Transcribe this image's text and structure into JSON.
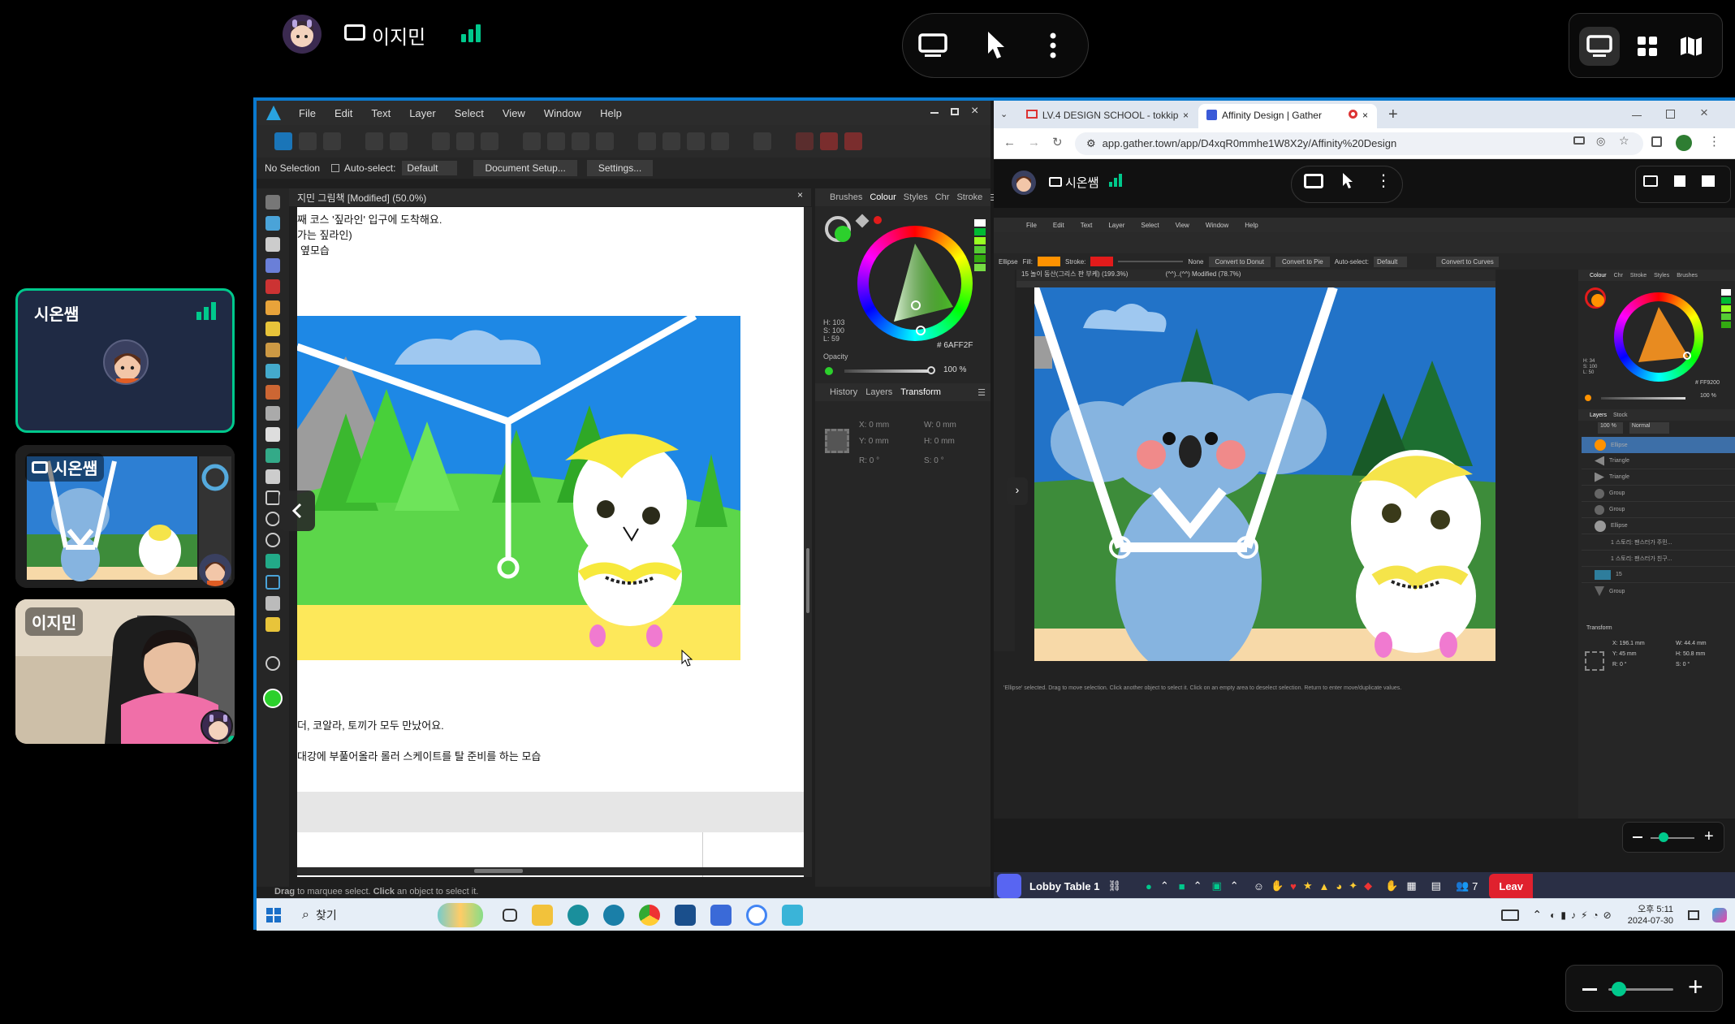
{
  "top": {
    "presenter_name": "이지민",
    "view_buttons": [
      "screen-share-icon",
      "cursor-icon",
      "more-vertical-icon"
    ],
    "layout_buttons": [
      "screen-layout-icon",
      "grid-layout-icon",
      "map-icon"
    ]
  },
  "participants": [
    {
      "name": "시온쌤"
    },
    {
      "name": "시온쌤"
    },
    {
      "name": "이지민"
    }
  ],
  "affinity_left": {
    "menu": [
      "File",
      "Edit",
      "Text",
      "Layer",
      "Select",
      "View",
      "Window",
      "Help"
    ],
    "context": {
      "no_selection": "No Selection",
      "auto_select": "Auto-select:",
      "default": "Default",
      "doc_setup": "Document Setup...",
      "settings": "Settings..."
    },
    "doc_tab": "지민 그림책 [Modified] (50.0%)",
    "text_lines": [
      "째 코스 '짚라인' 입구에 도착해요.",
      "가는 짚라인)",
      "옆모습"
    ],
    "text_lines2": [
      "더, 코알라, 토끼가 모두 만났어요.",
      "대강에 부풀어올라 롤러 스케이트를 탈 준비를 하는 모습"
    ],
    "panel_tabs": [
      "Brushes",
      "Colour",
      "Styles",
      "Chr",
      "Stroke"
    ],
    "hsl": [
      "H: 103",
      "S: 100",
      "L: 59"
    ],
    "hex": "6AFF2F",
    "opacity_label": "Opacity",
    "opacity_value": "100 %",
    "panel_tabs2": [
      "History",
      "Layers",
      "Transform"
    ],
    "transform": {
      "x": "0 mm",
      "y": "0 mm",
      "w": "0 mm",
      "h": "0 mm",
      "r": "0 °",
      "s": "0 °"
    },
    "status": "Drag to marquee select. Click an object to select it.",
    "status_drag": "Drag",
    "status_mid": " to marquee select. ",
    "status_click": "Click",
    "status_end": " an object to select it."
  },
  "browser": {
    "tab1": "LV.4 DESIGN SCHOOL - tokkip",
    "tab2": "Affinity Design | Gather",
    "url": "app.gather.town/app/D4xqR0mmhe1W8X2y/Affinity%20Design",
    "inner_name": "시온쌤"
  },
  "affinity_right": {
    "menu": [
      "File",
      "Edit",
      "Text",
      "Layer",
      "Select",
      "View",
      "Window",
      "Help"
    ],
    "context": [
      "Ellipse",
      "Fill:",
      "Stroke:",
      "None",
      "Convert to Donut",
      "Convert to Pie",
      "Auto-select:",
      "Default",
      "Convert to Curves"
    ],
    "doc_tab": "15 놀이 동산(그리스 판 부케) (199.3%)",
    "doc_tab2": "(^^)..(^^) Modified (78.7%)",
    "panel_tabs": [
      "Colour",
      "Chr",
      "Stroke",
      "Styles",
      "Brushes"
    ],
    "hex": "FF9200",
    "hsl": [
      "H: 34",
      "S: 100",
      "L: 50"
    ],
    "opacity_value": "100 %",
    "layers_tabs": [
      "Layers",
      "Stock"
    ],
    "layers_opacity": "100 %",
    "blend": "Normal",
    "layers": [
      "Ellipse",
      "Triangle",
      "Triangle",
      "Group",
      "Group",
      "Ellipse",
      "1 스토리: 팬스터가 주민...",
      "1 스토리: 팬스터가 친구...",
      "15",
      "Group"
    ],
    "transform_title": "Transform",
    "transform": {
      "x": "196.1 mm",
      "y": "45 mm",
      "w": "44.4 mm",
      "h": "50.8 mm",
      "r": "0 °",
      "s": "0 °"
    },
    "status": "'Ellipse' selected. Drag to move selection. Click another object to select it. Click on an empty area to deselect selection. Return to enter move/duplicate values."
  },
  "gather_bar": {
    "room": "Lobby Table 1",
    "participants_count": "7",
    "leave": "Leav"
  },
  "taskbar": {
    "search": "찾기",
    "time": "오후 5:11",
    "date": "2024-07-30"
  },
  "colors": {
    "accent_green": "#00c98c",
    "sky": "#1e88e5",
    "grass": "#5cd64a",
    "sand": "#fde85a",
    "fill_orange": "#ff9200",
    "stroke_red": "#e21b1b",
    "leave_red": "#e0212e",
    "share_blue": "#0a7ad0"
  }
}
